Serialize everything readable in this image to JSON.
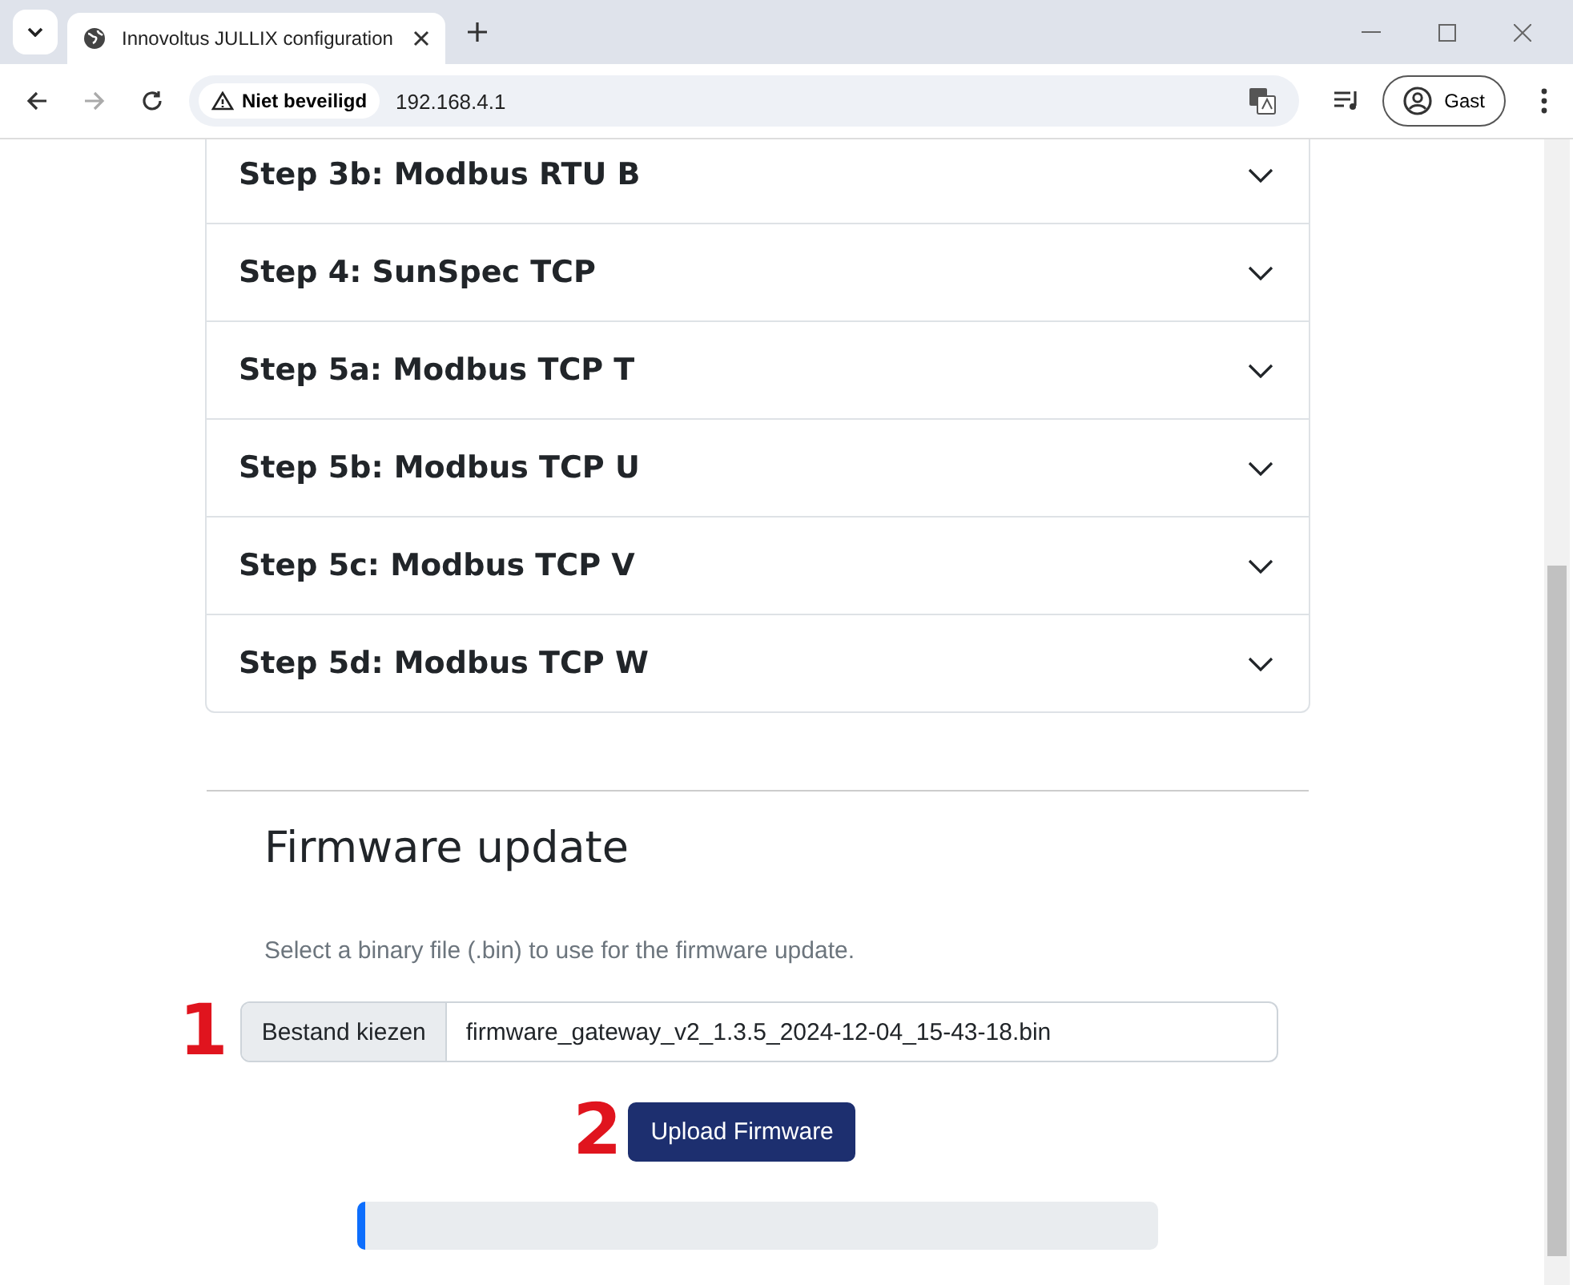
{
  "browser": {
    "tab_title": "Innovoltus JULLIX configuration",
    "security": "Niet beveiligd",
    "url": "192.168.4.1",
    "profile": "Gast"
  },
  "accordion": [
    {
      "title": "Step 3b: Modbus RTU B",
      "expanded": false
    },
    {
      "title": "Step 4: SunSpec TCP",
      "expanded": false
    },
    {
      "title": "Step 5a: Modbus TCP T",
      "expanded": false
    },
    {
      "title": "Step 5b: Modbus TCP U",
      "expanded": false
    },
    {
      "title": "Step 5c: Modbus TCP V",
      "expanded": false
    },
    {
      "title": "Step 5d: Modbus TCP W",
      "expanded": false
    }
  ],
  "firmware": {
    "heading": "Firmware update",
    "hint": "Select a binary file (.bin) to use for the firmware update.",
    "file_button": "Bestand kiezen",
    "file_name": "firmware_gateway_v2_1.3.5_2024-12-04_15-43-18.bin",
    "upload_button": "Upload Firmware",
    "progress": {
      "level": 0.01
    }
  },
  "annotations": [
    "1",
    "2"
  ]
}
